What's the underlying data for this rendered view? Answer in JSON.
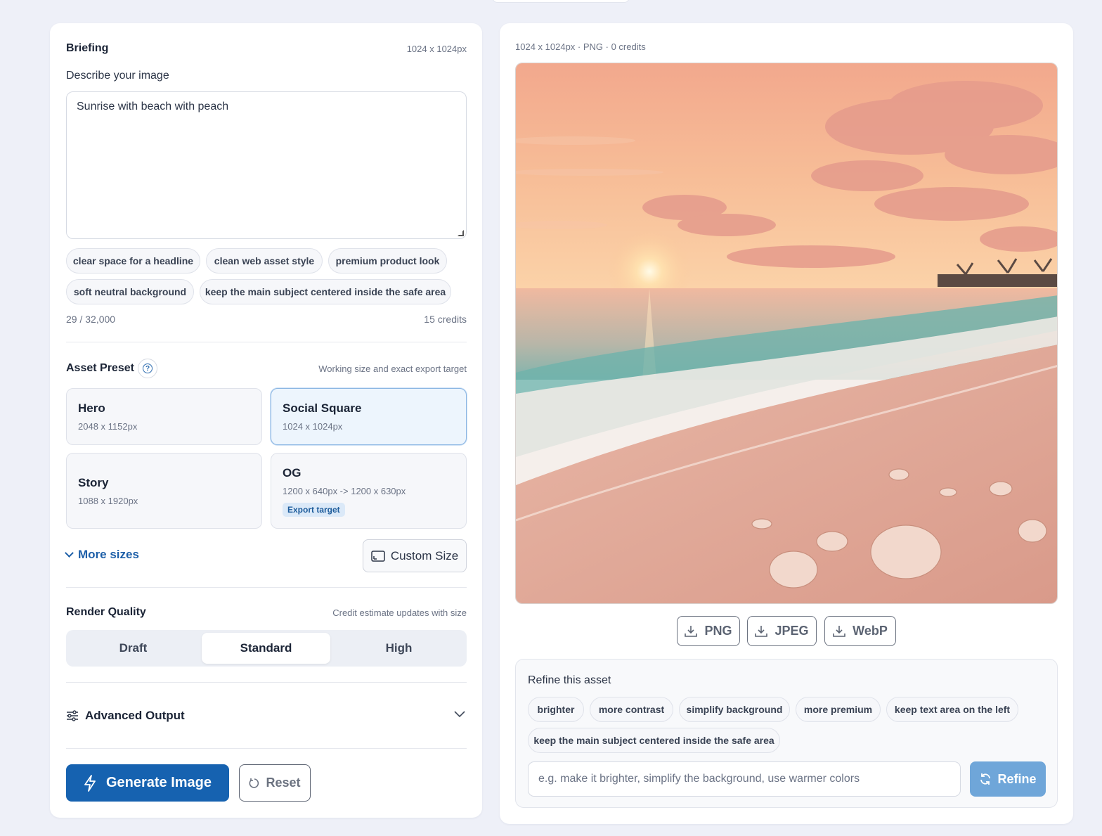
{
  "briefing": {
    "title": "Briefing",
    "size_meta": "1024 x 1024px",
    "describe_label": "Describe your image",
    "prompt_value": "Sunrise with beach with peach",
    "suggestions": [
      "clear space for a headline",
      "clean web asset style",
      "premium product look",
      "soft neutral background",
      "keep the main subject centered inside the safe area"
    ],
    "char_count": "29 / 32,000",
    "credits": "15 credits"
  },
  "preset": {
    "title": "Asset Preset",
    "help_icon": "question-circle-icon",
    "hint": "Working size and exact export target",
    "cards": [
      {
        "title": "Hero",
        "sub": "2048 x 1152px"
      },
      {
        "title": "Social Square",
        "sub": "1024 x 1024px"
      },
      {
        "title": "Story",
        "sub": "1088 x 1920px"
      },
      {
        "title": "OG",
        "sub": "1200 x 640px -> 1200 x 630px",
        "badge": "Export target"
      }
    ],
    "more_sizes": "More sizes",
    "custom_size": "Custom Size"
  },
  "quality": {
    "title": "Render Quality",
    "hint": "Credit estimate updates with size",
    "options": [
      "Draft",
      "Standard",
      "High"
    ],
    "selected": "Standard"
  },
  "advanced": {
    "title": "Advanced Output"
  },
  "actions": {
    "generate": "Generate Image",
    "reset": "Reset"
  },
  "preview": {
    "meta": "1024 x 1024px · PNG · 0 credits",
    "downloads": [
      "PNG",
      "JPEG",
      "WebP"
    ],
    "refine_title": "Refine this asset",
    "refine_chips": [
      "brighter",
      "more contrast",
      "simplify background",
      "more premium",
      "keep text area on the left",
      "keep the main subject centered inside the safe area"
    ],
    "refine_placeholder": "e.g. make it brighter, simplify the background, use warmer colors",
    "refine_button": "Refine"
  },
  "colors": {
    "primary": "#1662b0",
    "refine_button": "#6fa6d9",
    "active_card_bg": "#edf5fd"
  }
}
